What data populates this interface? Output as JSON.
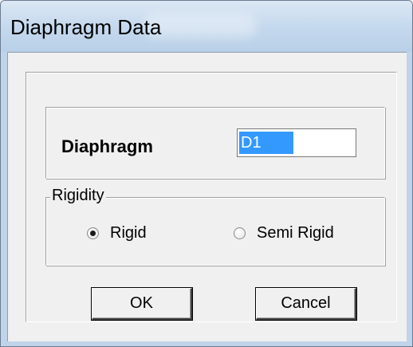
{
  "window": {
    "title": "Diaphragm Data"
  },
  "diaphragm": {
    "label": "Diaphragm",
    "value": "D1"
  },
  "rigidity": {
    "legend": "Rigidity",
    "options": [
      {
        "label": "Rigid",
        "selected": true
      },
      {
        "label": "Semi Rigid",
        "selected": false
      }
    ]
  },
  "buttons": {
    "ok_label": "OK",
    "cancel_label": "Cancel"
  },
  "colors": {
    "selection": "#3399ff",
    "titlebar": "#c4d8ed",
    "dialog_bg": "#f0f0f0"
  }
}
